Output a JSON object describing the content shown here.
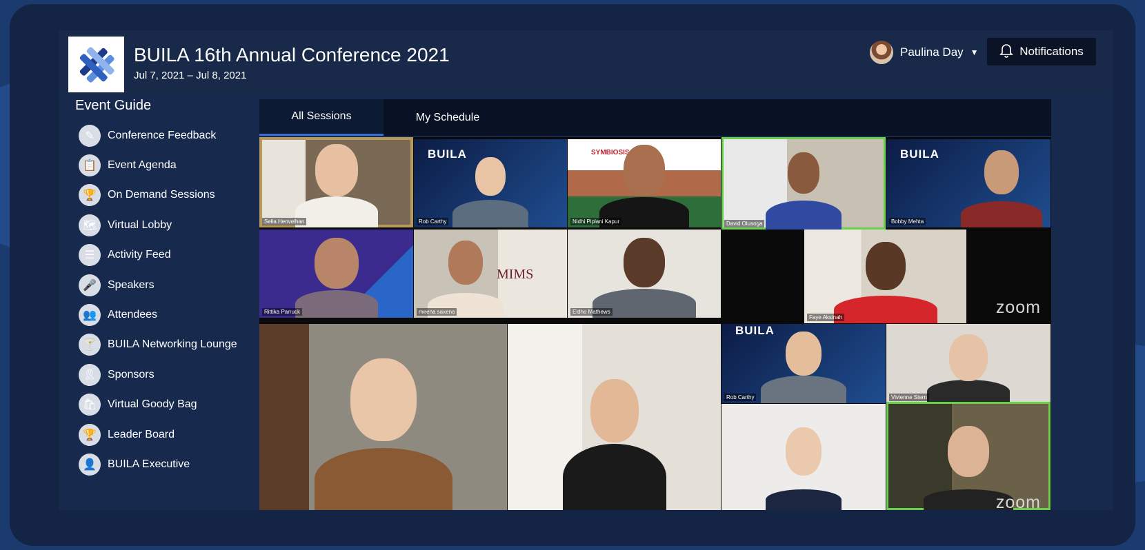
{
  "event": {
    "title": "BUILA 16th Annual Conference 2021",
    "dates": "Jul 7, 2021 – Jul 8, 2021"
  },
  "user": {
    "name": "Paulina Day"
  },
  "notifications": {
    "label": "Notifications"
  },
  "sidebar": {
    "title": "Event Guide",
    "items": [
      {
        "label": "Conference Feedback",
        "icon": "pencil-icon"
      },
      {
        "label": "Event Agenda",
        "icon": "agenda-icon"
      },
      {
        "label": "On Demand Sessions",
        "icon": "trophy-icon"
      },
      {
        "label": "Virtual Lobby",
        "icon": "map-icon"
      },
      {
        "label": "Activity Feed",
        "icon": "feed-icon"
      },
      {
        "label": "Speakers",
        "icon": "microphone-icon"
      },
      {
        "label": "Attendees",
        "icon": "people-icon"
      },
      {
        "label": "BUILA Networking Lounge",
        "icon": "cocktail-icon"
      },
      {
        "label": "Sponsors",
        "icon": "ribbon-icon"
      },
      {
        "label": "Virtual Goody Bag",
        "icon": "bag-icon"
      },
      {
        "label": "Leader Board",
        "icon": "trophy-icon"
      },
      {
        "label": "BUILA Executive",
        "icon": "person-icon"
      }
    ]
  },
  "tabs": [
    {
      "label": "All Sessions",
      "active": true
    },
    {
      "label": "My Schedule",
      "active": false
    }
  ],
  "participants": [
    {
      "name": "Sella Henvelhan"
    },
    {
      "name": "Rob Carthy"
    },
    {
      "name": "Nidhi Piplani Kapur"
    },
    {
      "name": "David Olusoga"
    },
    {
      "name": "Bobby Mehta"
    },
    {
      "name": "Rittika Parruck"
    },
    {
      "name": "meena saxena"
    },
    {
      "name": "Eldho Mathews"
    },
    {
      "name": "Faye Aksinah"
    },
    {
      "name": "Rob Carthy"
    },
    {
      "name": "Vivienne Stern"
    }
  ],
  "overlays": {
    "brand": "BUILA",
    "zoom": "zoom",
    "symbiosis": "SYMBIOSIS",
    "mims": "MIMS"
  }
}
